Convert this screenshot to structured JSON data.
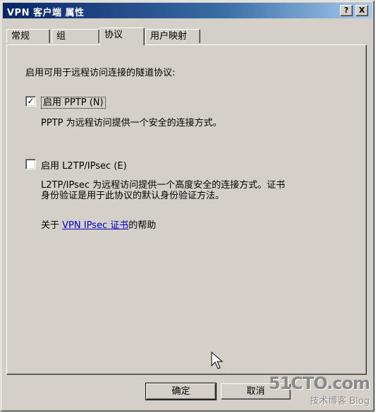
{
  "window": {
    "title": "VPN 客户端 属性",
    "help_btn": "?",
    "close_btn": "X"
  },
  "tabs": [
    {
      "label": "常规",
      "active": false
    },
    {
      "label": "组",
      "active": false
    },
    {
      "label": "协议",
      "active": true
    },
    {
      "label": "用户映射",
      "active": false
    }
  ],
  "panel": {
    "intro": "启用可用于远程访问连接的隧道协议:",
    "pptp": {
      "checked": true,
      "check_mark": "✓",
      "label": "启用 PPTP (N)",
      "description": "PPTP 为远程访问提供一个安全的连接方式。"
    },
    "l2tp": {
      "checked": false,
      "label": "启用 L2TP/IPsec (E)",
      "description_line1": "L2TP/IPsec 为远程访问提供一个高度安全的连接方式。证书",
      "description_line2": "身份验证是用于此协议的默认身份验证方法。"
    },
    "help": {
      "prefix": "关于 ",
      "link": "VPN IPsec 证书",
      "suffix": "的帮助"
    }
  },
  "buttons": {
    "ok": "确定",
    "cancel": "取消"
  },
  "watermark": {
    "top": "51CTO.com",
    "bottom": "技术博客",
    "blog": "Blog"
  }
}
